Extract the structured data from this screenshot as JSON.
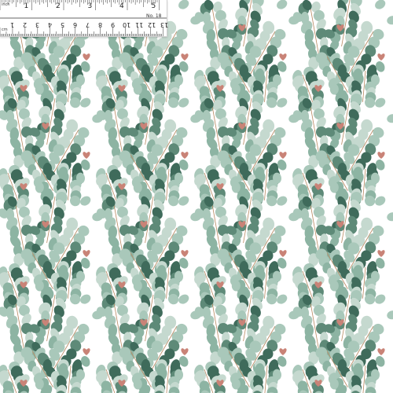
{
  "image": {
    "subject": "eucalyptus leaf fabric swatch",
    "background_color": "#ffffff",
    "leaf_colors": [
      "#3f6b5b",
      "#5e8a78",
      "#8db4a3",
      "#a9c8ba",
      "#c5d9cf"
    ],
    "stem_color": "#b98a63",
    "heart_color": "#c98377"
  },
  "ruler": {
    "top_unit": "inch",
    "top_numbers": [
      "1",
      "2",
      "3",
      "4",
      "5"
    ],
    "bottom_unit": "cm",
    "bottom_numbers": [
      "1",
      "2",
      "3",
      "4",
      "5",
      "6",
      "7",
      "8",
      "9",
      "10",
      "11",
      "12",
      "13"
    ],
    "swatch_label": "No. 18"
  }
}
